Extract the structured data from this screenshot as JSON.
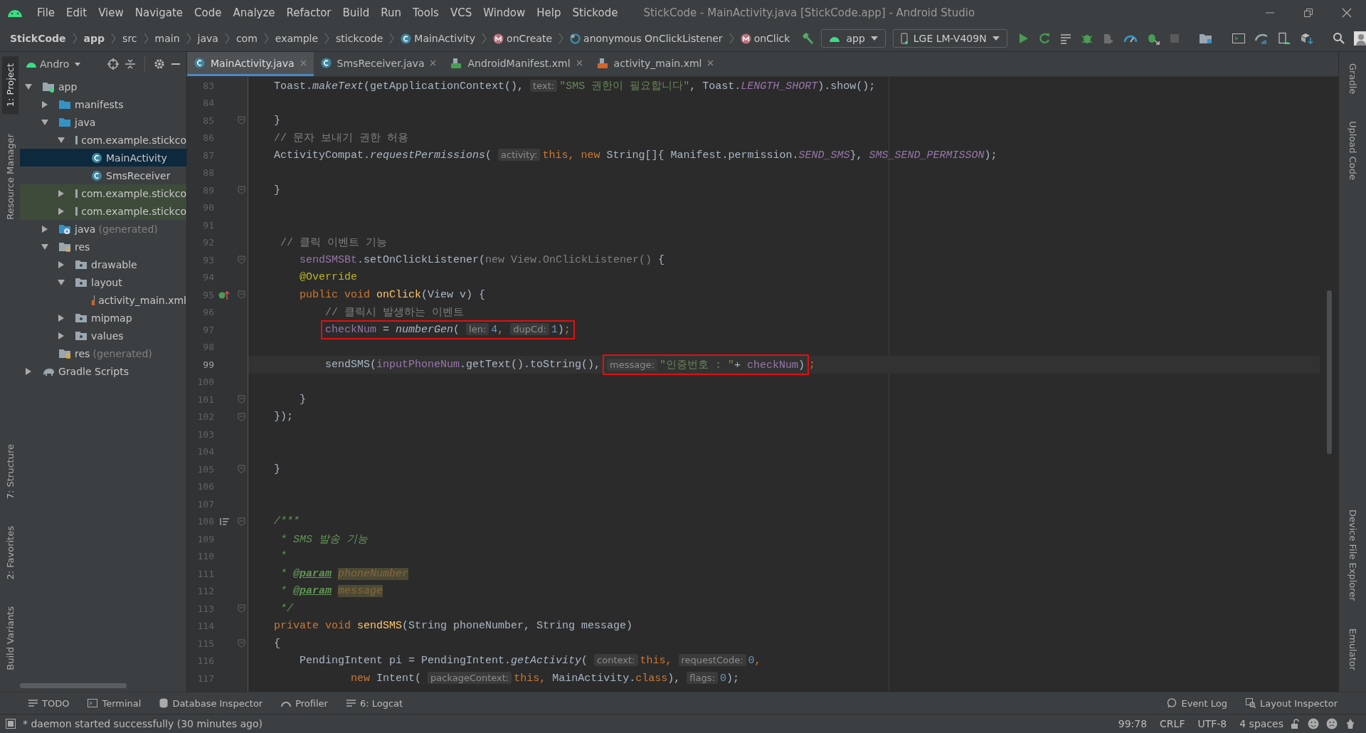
{
  "window": {
    "title": "StickCode - MainActivity.java [StickCode.app] - Android Studio"
  },
  "menu": [
    "File",
    "Edit",
    "View",
    "Navigate",
    "Code",
    "Analyze",
    "Refactor",
    "Build",
    "Run",
    "Tools",
    "VCS",
    "Window",
    "Help",
    "Stickode"
  ],
  "breadcrumbs": [
    {
      "label": "StickCode",
      "bold": true,
      "kind": "plain"
    },
    {
      "label": "app",
      "bold": true,
      "kind": "plain"
    },
    {
      "label": "src",
      "bold": false,
      "kind": "plain"
    },
    {
      "label": "main",
      "bold": false,
      "kind": "plain"
    },
    {
      "label": "java",
      "bold": false,
      "kind": "plain"
    },
    {
      "label": "com",
      "bold": false,
      "kind": "plain"
    },
    {
      "label": "example",
      "bold": false,
      "kind": "plain"
    },
    {
      "label": "stickcode",
      "bold": false,
      "kind": "plain"
    },
    {
      "label": "MainActivity",
      "bold": false,
      "kind": "class"
    },
    {
      "label": "onCreate",
      "bold": false,
      "kind": "method"
    },
    {
      "label": "anonymous OnClickListener",
      "bold": false,
      "kind": "anonymous"
    },
    {
      "label": "onClick",
      "bold": false,
      "kind": "method"
    }
  ],
  "run_config": "app",
  "device": "LGE LM-V409N",
  "left_stripe": {
    "top": [
      {
        "label": "1: Project",
        "selected": true
      },
      {
        "label": "Resource Manager",
        "selected": false
      }
    ],
    "bottom": [
      {
        "label": "7: Structure",
        "selected": false
      },
      {
        "label": "2: Favorites",
        "selected": false
      },
      {
        "label": "Build Variants",
        "selected": false
      }
    ]
  },
  "right_stripe": {
    "top": [
      {
        "label": "Gradle"
      },
      {
        "label": "Upload Code"
      }
    ],
    "bottom": [
      {
        "label": "Device File Explorer"
      },
      {
        "label": "Emulator"
      }
    ]
  },
  "project": {
    "view": "Andro",
    "tree": [
      {
        "label": "app",
        "kind": "module",
        "expanded": true,
        "selected": false,
        "tinted": false,
        "children": [
          {
            "label": "manifests",
            "kind": "folder",
            "expanded": false,
            "selected": false,
            "tinted": false
          },
          {
            "label": "java",
            "kind": "folder",
            "expanded": true,
            "selected": false,
            "tinted": false,
            "children": [
              {
                "label": "com.example.stickco",
                "kind": "package",
                "expanded": true,
                "selected": false,
                "tinted": false,
                "children": [
                  {
                    "label": "MainActivity",
                    "kind": "class",
                    "selected": true,
                    "tinted": false
                  },
                  {
                    "label": "SmsReceiver",
                    "kind": "class",
                    "selected": false,
                    "tinted": false
                  }
                ]
              },
              {
                "label": "com.example.stickco",
                "kind": "package",
                "expanded": false,
                "selected": false,
                "tinted": true
              },
              {
                "label": "com.example.stickco",
                "kind": "package",
                "expanded": false,
                "selected": false,
                "tinted": true
              }
            ]
          },
          {
            "label": "java",
            "note": "(generated)",
            "kind": "generated",
            "expanded": false,
            "selected": false,
            "tinted": false
          },
          {
            "label": "res",
            "kind": "res",
            "expanded": true,
            "selected": false,
            "tinted": false,
            "children": [
              {
                "label": "drawable",
                "kind": "package",
                "expanded": false,
                "selected": false,
                "tinted": false
              },
              {
                "label": "layout",
                "kind": "package",
                "expanded": true,
                "selected": false,
                "tinted": false,
                "children": [
                  {
                    "label": "activity_main.xml",
                    "kind": "xml",
                    "selected": false,
                    "tinted": false
                  }
                ]
              },
              {
                "label": "mipmap",
                "kind": "package",
                "expanded": false,
                "selected": false,
                "tinted": false
              },
              {
                "label": "values",
                "kind": "package",
                "expanded": false,
                "selected": false,
                "tinted": false
              }
            ]
          },
          {
            "label": "res",
            "note": "(generated)",
            "kind": "res",
            "selected": false,
            "tinted": false
          }
        ]
      },
      {
        "label": "Gradle Scripts",
        "kind": "gradle",
        "expanded": false,
        "selected": false,
        "tinted": false
      }
    ]
  },
  "tabs": [
    {
      "label": "MainActivity.java",
      "kind": "class",
      "selected": true
    },
    {
      "label": "SmsReceiver.java",
      "kind": "class",
      "selected": false
    },
    {
      "label": "AndroidManifest.xml",
      "kind": "manifest",
      "selected": false
    },
    {
      "label": "activity_main.xml",
      "kind": "xml",
      "selected": false
    }
  ],
  "editor": {
    "lines": [
      {
        "number": "83",
        "kind": "plain",
        "fold": false,
        "current": false,
        "tokens": [
          {
            "kind": "plain",
            "text": "    Toast."
          },
          {
            "kind": "italic",
            "text": "makeText"
          },
          {
            "kind": "plain",
            "text": "(getApplicationContext(), "
          },
          {
            "kind": "hint",
            "text": "text:"
          },
          {
            "kind": "string",
            "text": "\"SMS 권한이 필요합니다\""
          },
          {
            "kind": "plain",
            "text": ", Toast."
          },
          {
            "kind": "constant",
            "text": "LENGTH_SHORT"
          },
          {
            "kind": "plain",
            "text": ").show();"
          }
        ]
      },
      {
        "number": "84",
        "kind": "plain",
        "fold": false,
        "current": false
      },
      {
        "number": "85",
        "kind": "plain",
        "fold": true,
        "current": false,
        "tokens": [
          {
            "kind": "plain",
            "text": "    }"
          }
        ]
      },
      {
        "number": "86",
        "kind": "plain",
        "fold": false,
        "current": false,
        "tokens": [
          {
            "kind": "comment",
            "text": "    // 문자 보내기 권한 허용"
          }
        ]
      },
      {
        "number": "87",
        "kind": "plain",
        "fold": false,
        "current": false,
        "tokens": [
          {
            "kind": "plain",
            "text": "    ActivityCompat."
          },
          {
            "kind": "italic",
            "text": "requestPermissions"
          },
          {
            "kind": "plain",
            "text": "( "
          },
          {
            "kind": "hint",
            "text": "activity:"
          },
          {
            "kind": "keyword",
            "text": "this, new "
          },
          {
            "kind": "plain",
            "text": "String[]{ Manifest.permission."
          },
          {
            "kind": "constant",
            "text": "SEND_SMS"
          },
          {
            "kind": "plain",
            "text": "}, "
          },
          {
            "kind": "constant",
            "text": "SMS_SEND_PERMISSON"
          },
          {
            "kind": "plain",
            "text": ");"
          }
        ]
      },
      {
        "number": "88",
        "kind": "plain",
        "fold": false,
        "current": false
      },
      {
        "number": "89",
        "kind": "plain",
        "fold": true,
        "current": false,
        "tokens": [
          {
            "kind": "plain",
            "text": "    }"
          }
        ]
      },
      {
        "number": "90",
        "kind": "plain",
        "fold": false,
        "current": false
      },
      {
        "number": "91",
        "kind": "plain",
        "fold": false,
        "current": false
      },
      {
        "number": "92",
        "kind": "plain",
        "fold": false,
        "current": false,
        "tokens": [
          {
            "kind": "comment",
            "text": "     // 클릭 이벤트 기능"
          }
        ]
      },
      {
        "number": "93",
        "kind": "plain",
        "fold": true,
        "current": false,
        "tokens": [
          {
            "kind": "field",
            "text": "        sendSMSBt"
          },
          {
            "kind": "plain",
            "text": ".setOnClickListener("
          },
          {
            "kind": "dim",
            "text": "new View.OnClickListener()"
          },
          {
            "kind": "plain",
            "text": " {"
          }
        ]
      },
      {
        "number": "94",
        "kind": "plain",
        "fold": false,
        "current": false,
        "tokens": [
          {
            "kind": "annotation",
            "text": "        @Override"
          }
        ]
      },
      {
        "number": "95",
        "kind": "override",
        "fold": true,
        "current": false,
        "tokens": [
          {
            "kind": "keyword",
            "text": "        public void "
          },
          {
            "kind": "declaration",
            "text": "onClick"
          },
          {
            "kind": "plain",
            "text": "(View v) {"
          }
        ]
      },
      {
        "number": "96",
        "kind": "plain",
        "fold": false,
        "current": false,
        "tokens": [
          {
            "kind": "comment",
            "text": "            // 클릭시 발생하는 이벤트"
          }
        ]
      },
      {
        "number": "97",
        "kind": "plain",
        "fold": false,
        "current": false,
        "tokens": [
          {
            "kind": "outline",
            "tokens": [
              {
                "kind": "field",
                "text": "checkNum"
              },
              {
                "kind": "plain",
                "text": " = "
              },
              {
                "kind": "italic",
                "text": "numberGen"
              },
              {
                "kind": "plain",
                "text": "( "
              },
              {
                "kind": "hint",
                "text": "len:"
              },
              {
                "kind": "number",
                "text": "4"
              },
              {
                "kind": "keyword",
                "text": ", "
              },
              {
                "kind": "hint",
                "text": "dupCd:"
              },
              {
                "kind": "number",
                "text": "1"
              },
              {
                "kind": "plain",
                "text": ")"
              },
              {
                "kind": "keyword",
                "text": ";"
              }
            ]
          }
        ]
      },
      {
        "number": "98",
        "kind": "plain",
        "fold": false,
        "current": false
      },
      {
        "number": "99",
        "kind": "plain",
        "fold": false,
        "current": true,
        "tokens": [
          {
            "kind": "plain",
            "text": "            sendSMS("
          },
          {
            "kind": "field",
            "text": "inputPhoneNum"
          },
          {
            "kind": "plain",
            "text": ".getText().toString(), "
          },
          {
            "kind": "outline",
            "tokens": [
              {
                "kind": "hint",
                "text": "message:"
              },
              {
                "kind": "string",
                "text": "\"인증번호 : \""
              },
              {
                "kind": "plain",
                "text": "+ "
              },
              {
                "kind": "field",
                "text": "checkNum"
              },
              {
                "kind": "plain",
                "text": ")"
              }
            ]
          },
          {
            "kind": "keyword",
            "text": ";"
          }
        ]
      },
      {
        "number": "100",
        "kind": "plain",
        "fold": false,
        "current": false
      },
      {
        "number": "101",
        "kind": "plain",
        "fold": true,
        "current": false,
        "tokens": [
          {
            "kind": "plain",
            "text": "        }"
          }
        ]
      },
      {
        "number": "102",
        "kind": "plain",
        "fold": true,
        "current": false,
        "tokens": [
          {
            "kind": "plain",
            "text": "    });"
          }
        ]
      },
      {
        "number": "103",
        "kind": "plain",
        "fold": false,
        "current": false
      },
      {
        "number": "104",
        "kind": "plain",
        "fold": false,
        "current": false
      },
      {
        "number": "105",
        "kind": "plain",
        "fold": true,
        "current": false,
        "tokens": [
          {
            "kind": "plain",
            "text": "    }"
          }
        ]
      },
      {
        "number": "106",
        "kind": "plain",
        "fold": false,
        "current": false
      },
      {
        "number": "107",
        "kind": "plain",
        "fold": false,
        "current": false
      },
      {
        "number": "108",
        "kind": "doc",
        "fold": true,
        "current": false,
        "tokens": [
          {
            "kind": "doc",
            "text": "    /***"
          }
        ]
      },
      {
        "number": "109",
        "kind": "plain",
        "fold": false,
        "current": false,
        "tokens": [
          {
            "kind": "doc",
            "text": "     * SMS 발송 기능"
          }
        ]
      },
      {
        "number": "110",
        "kind": "plain",
        "fold": false,
        "current": false,
        "tokens": [
          {
            "kind": "doc",
            "text": "     *"
          }
        ]
      },
      {
        "number": "111",
        "kind": "plain",
        "fold": false,
        "current": false,
        "tokens": [
          {
            "kind": "doc",
            "text": "     * "
          },
          {
            "kind": "doctag",
            "text": "@param"
          },
          {
            "kind": "docparam",
            "text": "phoneNumber"
          }
        ]
      },
      {
        "number": "112",
        "kind": "plain",
        "fold": false,
        "current": false,
        "tokens": [
          {
            "kind": "doc",
            "text": "     * "
          },
          {
            "kind": "doctag",
            "text": "@param"
          },
          {
            "kind": "docparam",
            "text": "message"
          }
        ]
      },
      {
        "number": "113",
        "kind": "plain",
        "fold": true,
        "current": false,
        "tokens": [
          {
            "kind": "doc",
            "text": "     */"
          }
        ]
      },
      {
        "number": "114",
        "kind": "plain",
        "fold": false,
        "current": false,
        "tokens": [
          {
            "kind": "keyword",
            "text": "    private void "
          },
          {
            "kind": "declaration",
            "text": "sendSMS"
          },
          {
            "kind": "plain",
            "text": "(String phoneNumber, String message)"
          }
        ]
      },
      {
        "number": "115",
        "kind": "plain",
        "fold": true,
        "current": false,
        "tokens": [
          {
            "kind": "plain",
            "text": "    {"
          }
        ]
      },
      {
        "number": "116",
        "kind": "plain",
        "fold": false,
        "current": false,
        "tokens": [
          {
            "kind": "plain",
            "text": "        PendingIntent pi = PendingIntent."
          },
          {
            "kind": "italic",
            "text": "getActivity"
          },
          {
            "kind": "plain",
            "text": "( "
          },
          {
            "kind": "hint",
            "text": "context:"
          },
          {
            "kind": "keyword",
            "text": "this, "
          },
          {
            "kind": "hint",
            "text": "requestCode:"
          },
          {
            "kind": "number",
            "text": "0"
          },
          {
            "kind": "keyword",
            "text": ","
          }
        ]
      },
      {
        "number": "117",
        "kind": "plain",
        "fold": false,
        "current": false,
        "tokens": [
          {
            "kind": "keyword",
            "text": "                new "
          },
          {
            "kind": "plain",
            "text": "Intent( "
          },
          {
            "kind": "hint",
            "text": "packageContext:"
          },
          {
            "kind": "keyword",
            "text": "this, "
          },
          {
            "kind": "plain",
            "text": "MainActivity."
          },
          {
            "kind": "keyword",
            "text": "class"
          },
          {
            "kind": "plain",
            "text": "), "
          },
          {
            "kind": "hint",
            "text": "flags:"
          },
          {
            "kind": "number",
            "text": "0"
          },
          {
            "kind": "plain",
            "text": ");"
          }
        ]
      }
    ]
  },
  "tool_windows": {
    "left": [
      {
        "label": "TODO",
        "kind": "list"
      },
      {
        "label": "Terminal",
        "kind": "terminal"
      },
      {
        "label": "Database Inspector",
        "kind": "database"
      },
      {
        "label": "Profiler",
        "kind": "gauge"
      },
      {
        "label": "6: Logcat",
        "kind": "list"
      }
    ],
    "right": [
      {
        "label": "Event Log",
        "kind": "bubble"
      },
      {
        "label": "Layout Inspector",
        "kind": "inspect"
      }
    ]
  },
  "status_bar": {
    "message": "* daemon started successfully (30 minutes ago)",
    "position": "99:78",
    "line_ending": "CRLF",
    "encoding": "UTF-8",
    "indent": "4 spaces"
  }
}
